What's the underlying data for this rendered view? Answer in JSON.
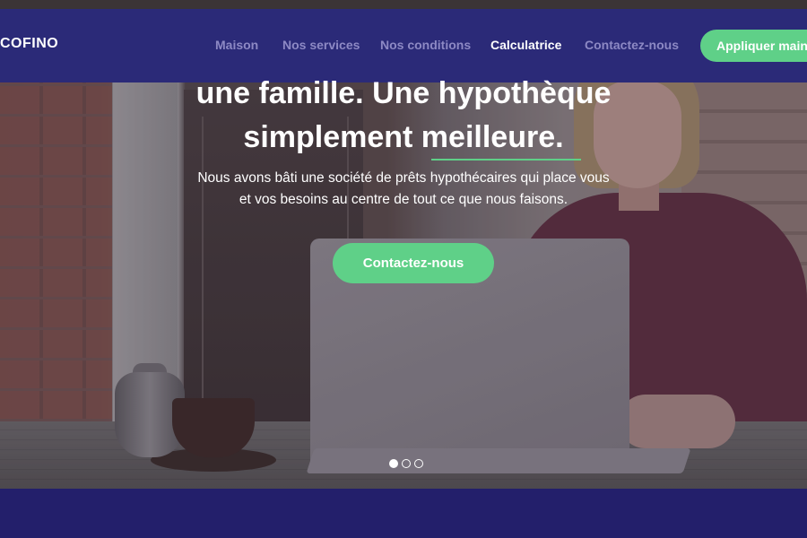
{
  "brand": {
    "logo_text": "COFINO"
  },
  "nav": {
    "items": [
      {
        "label": "Maison",
        "active": false
      },
      {
        "label": "Nos services",
        "active": false
      },
      {
        "label": "Nos conditions",
        "active": false
      },
      {
        "label": "Calculatrice",
        "active": true
      },
      {
        "label": "Contactez-nous",
        "active": false
      }
    ],
    "apply_button": "Appliquer maintenant"
  },
  "hero": {
    "headline_line1": "une famille. Une hypothèque",
    "headline_line2": "simplement meilleure.",
    "subtext_line1": "Nous avons bâti une société de prêts hypothécaires qui place vous",
    "subtext_line2": "et vos besoins au centre de tout ce que nous faisons.",
    "cta_label": "Contactez-nous",
    "carousel": {
      "slides": 3,
      "active_index": 0
    }
  },
  "colors": {
    "nav_bg": "#2b2a78",
    "accent_green": "#5fd088",
    "nav_link": "#8d89c4",
    "footer_bg": "#231f6b"
  }
}
